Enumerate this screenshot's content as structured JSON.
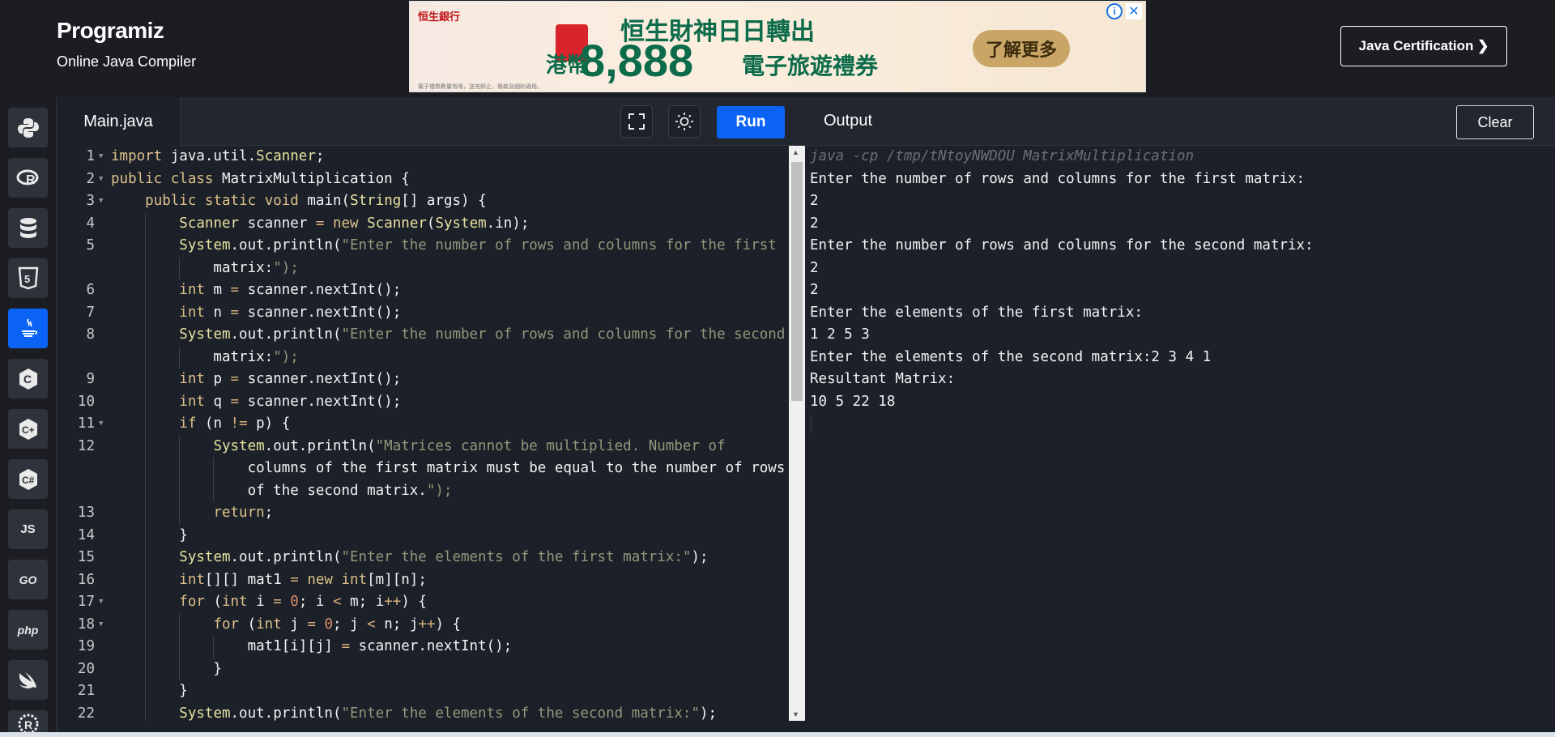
{
  "header": {
    "logo": "Programiz",
    "subtitle": "Online Java Compiler",
    "cert_button": "Java Certification ❯"
  },
  "ad": {
    "bank": "恒生銀行",
    "headline": "恒生財神日日轉出",
    "amount_prefix": "港幣",
    "amount": "8,888",
    "amount_suffix": "電子旅遊禮券",
    "cta": "了解更多",
    "fine_print": "電子禮券數量有限，送完即止。條款及細則適用。",
    "info_icon": "i",
    "close_icon": "✕"
  },
  "sidebar": {
    "items": [
      {
        "name": "python",
        "label": "Py"
      },
      {
        "name": "r",
        "label": "R"
      },
      {
        "name": "sql",
        "label": "SQL"
      },
      {
        "name": "html",
        "label": "5"
      },
      {
        "name": "java",
        "label": "☕",
        "active": true
      },
      {
        "name": "c",
        "label": "C"
      },
      {
        "name": "cpp",
        "label": "C++"
      },
      {
        "name": "csharp",
        "label": "C#"
      },
      {
        "name": "javascript",
        "label": "JS"
      },
      {
        "name": "go",
        "label": "GO"
      },
      {
        "name": "php",
        "label": "php"
      },
      {
        "name": "swift",
        "label": "Swift"
      },
      {
        "name": "rust",
        "label": "R"
      }
    ]
  },
  "editor": {
    "tab_label": "Main.java",
    "run_label": "Run",
    "lines": [
      {
        "num": "1",
        "text": "import java.util.Scanner;"
      },
      {
        "num": "2",
        "text": "public class MatrixMultiplication {"
      },
      {
        "num": "3",
        "text": "    public static void main(String[] args) {"
      },
      {
        "num": "4",
        "text": "        Scanner scanner = new Scanner(System.in);"
      },
      {
        "num": "5",
        "text": "        System.out.println(\"Enter the number of rows and columns for the first"
      },
      {
        "num": "",
        "text": "            matrix:\");"
      },
      {
        "num": "6",
        "text": "        int m = scanner.nextInt();"
      },
      {
        "num": "7",
        "text": "        int n = scanner.nextInt();"
      },
      {
        "num": "8",
        "text": "        System.out.println(\"Enter the number of rows and columns for the second"
      },
      {
        "num": "",
        "text": "            matrix:\");"
      },
      {
        "num": "9",
        "text": "        int p = scanner.nextInt();"
      },
      {
        "num": "10",
        "text": "        int q = scanner.nextInt();"
      },
      {
        "num": "11",
        "text": "        if (n != p) {"
      },
      {
        "num": "12",
        "text": "            System.out.println(\"Matrices cannot be multiplied. Number of"
      },
      {
        "num": "",
        "text": "                columns of the first matrix must be equal to the number of rows"
      },
      {
        "num": "",
        "text": "                of the second matrix.\");"
      },
      {
        "num": "13",
        "text": "            return;"
      },
      {
        "num": "14",
        "text": "        }"
      },
      {
        "num": "15",
        "text": "        System.out.println(\"Enter the elements of the first matrix:\");"
      },
      {
        "num": "16",
        "text": "        int[][] mat1 = new int[m][n];"
      },
      {
        "num": "17",
        "text": "        for (int i = 0; i < m; i++) {"
      },
      {
        "num": "18",
        "text": "            for (int j = 0; j < n; j++) {"
      },
      {
        "num": "19",
        "text": "                mat1[i][j] = scanner.nextInt();"
      },
      {
        "num": "20",
        "text": "            }"
      },
      {
        "num": "21",
        "text": "        }"
      },
      {
        "num": "22",
        "text": "        System.out.println(\"Enter the elements of the second matrix:\");"
      }
    ]
  },
  "output": {
    "title": "Output",
    "clear_label": "Clear",
    "lines": [
      "java -cp /tmp/tNtoyNWDOU MatrixMultiplication",
      "Enter the number of rows and columns for the first matrix:",
      "2",
      "2",
      "Enter the number of rows and columns for the second matrix:",
      "2",
      "2",
      "Enter the elements of the first matrix:",
      "1 2 5 3",
      "Enter the elements of the second matrix:2 3 4 1",
      "Resultant Matrix:",
      "10 5 22 18"
    ]
  }
}
